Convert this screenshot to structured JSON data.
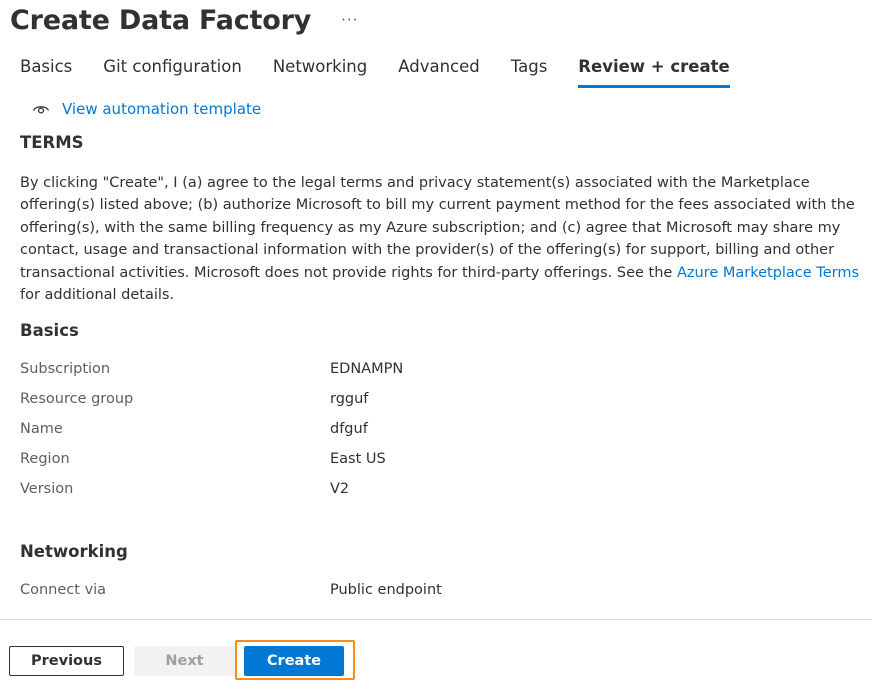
{
  "header": {
    "title": "Create Data Factory",
    "more_label": "···"
  },
  "tabs": [
    {
      "label": "Basics",
      "active": false
    },
    {
      "label": "Git configuration",
      "active": false
    },
    {
      "label": "Networking",
      "active": false
    },
    {
      "label": "Advanced",
      "active": false
    },
    {
      "label": "Tags",
      "active": false
    },
    {
      "label": "Review + create",
      "active": true
    }
  ],
  "automation": {
    "icon": "eye-icon",
    "label": "View automation template"
  },
  "terms": {
    "heading": "TERMS",
    "text_before": "By clicking \"Create\", I (a) agree to the legal terms and privacy statement(s) associated with the Marketplace offering(s) listed above; (b) authorize Microsoft to bill my current payment method for the fees associated with the offering(s), with the same billing frequency as my Azure subscription; and (c) agree that Microsoft may share my contact, usage and transactional information with the provider(s) of the offering(s) for support, billing and other transactional activities. Microsoft does not provide rights for third-party offerings. See the ",
    "link_text": "Azure Marketplace Terms",
    "text_after": " for additional details."
  },
  "basics": {
    "heading": "Basics",
    "rows": [
      {
        "label": "Subscription",
        "value": "EDNAMPN"
      },
      {
        "label": "Resource group",
        "value": "rgguf"
      },
      {
        "label": "Name",
        "value": "dfguf"
      },
      {
        "label": "Region",
        "value": "East US"
      },
      {
        "label": "Version",
        "value": "V2"
      }
    ]
  },
  "networking": {
    "heading": "Networking",
    "rows": [
      {
        "label": "Connect via",
        "value": "Public endpoint"
      }
    ]
  },
  "footer": {
    "previous_label": "Previous",
    "next_label": "Next",
    "create_label": "Create",
    "highlight_color": "#f68b1f"
  },
  "colors": {
    "accent": "#0078d4",
    "text": "#323130",
    "muted": "#605e5c"
  }
}
